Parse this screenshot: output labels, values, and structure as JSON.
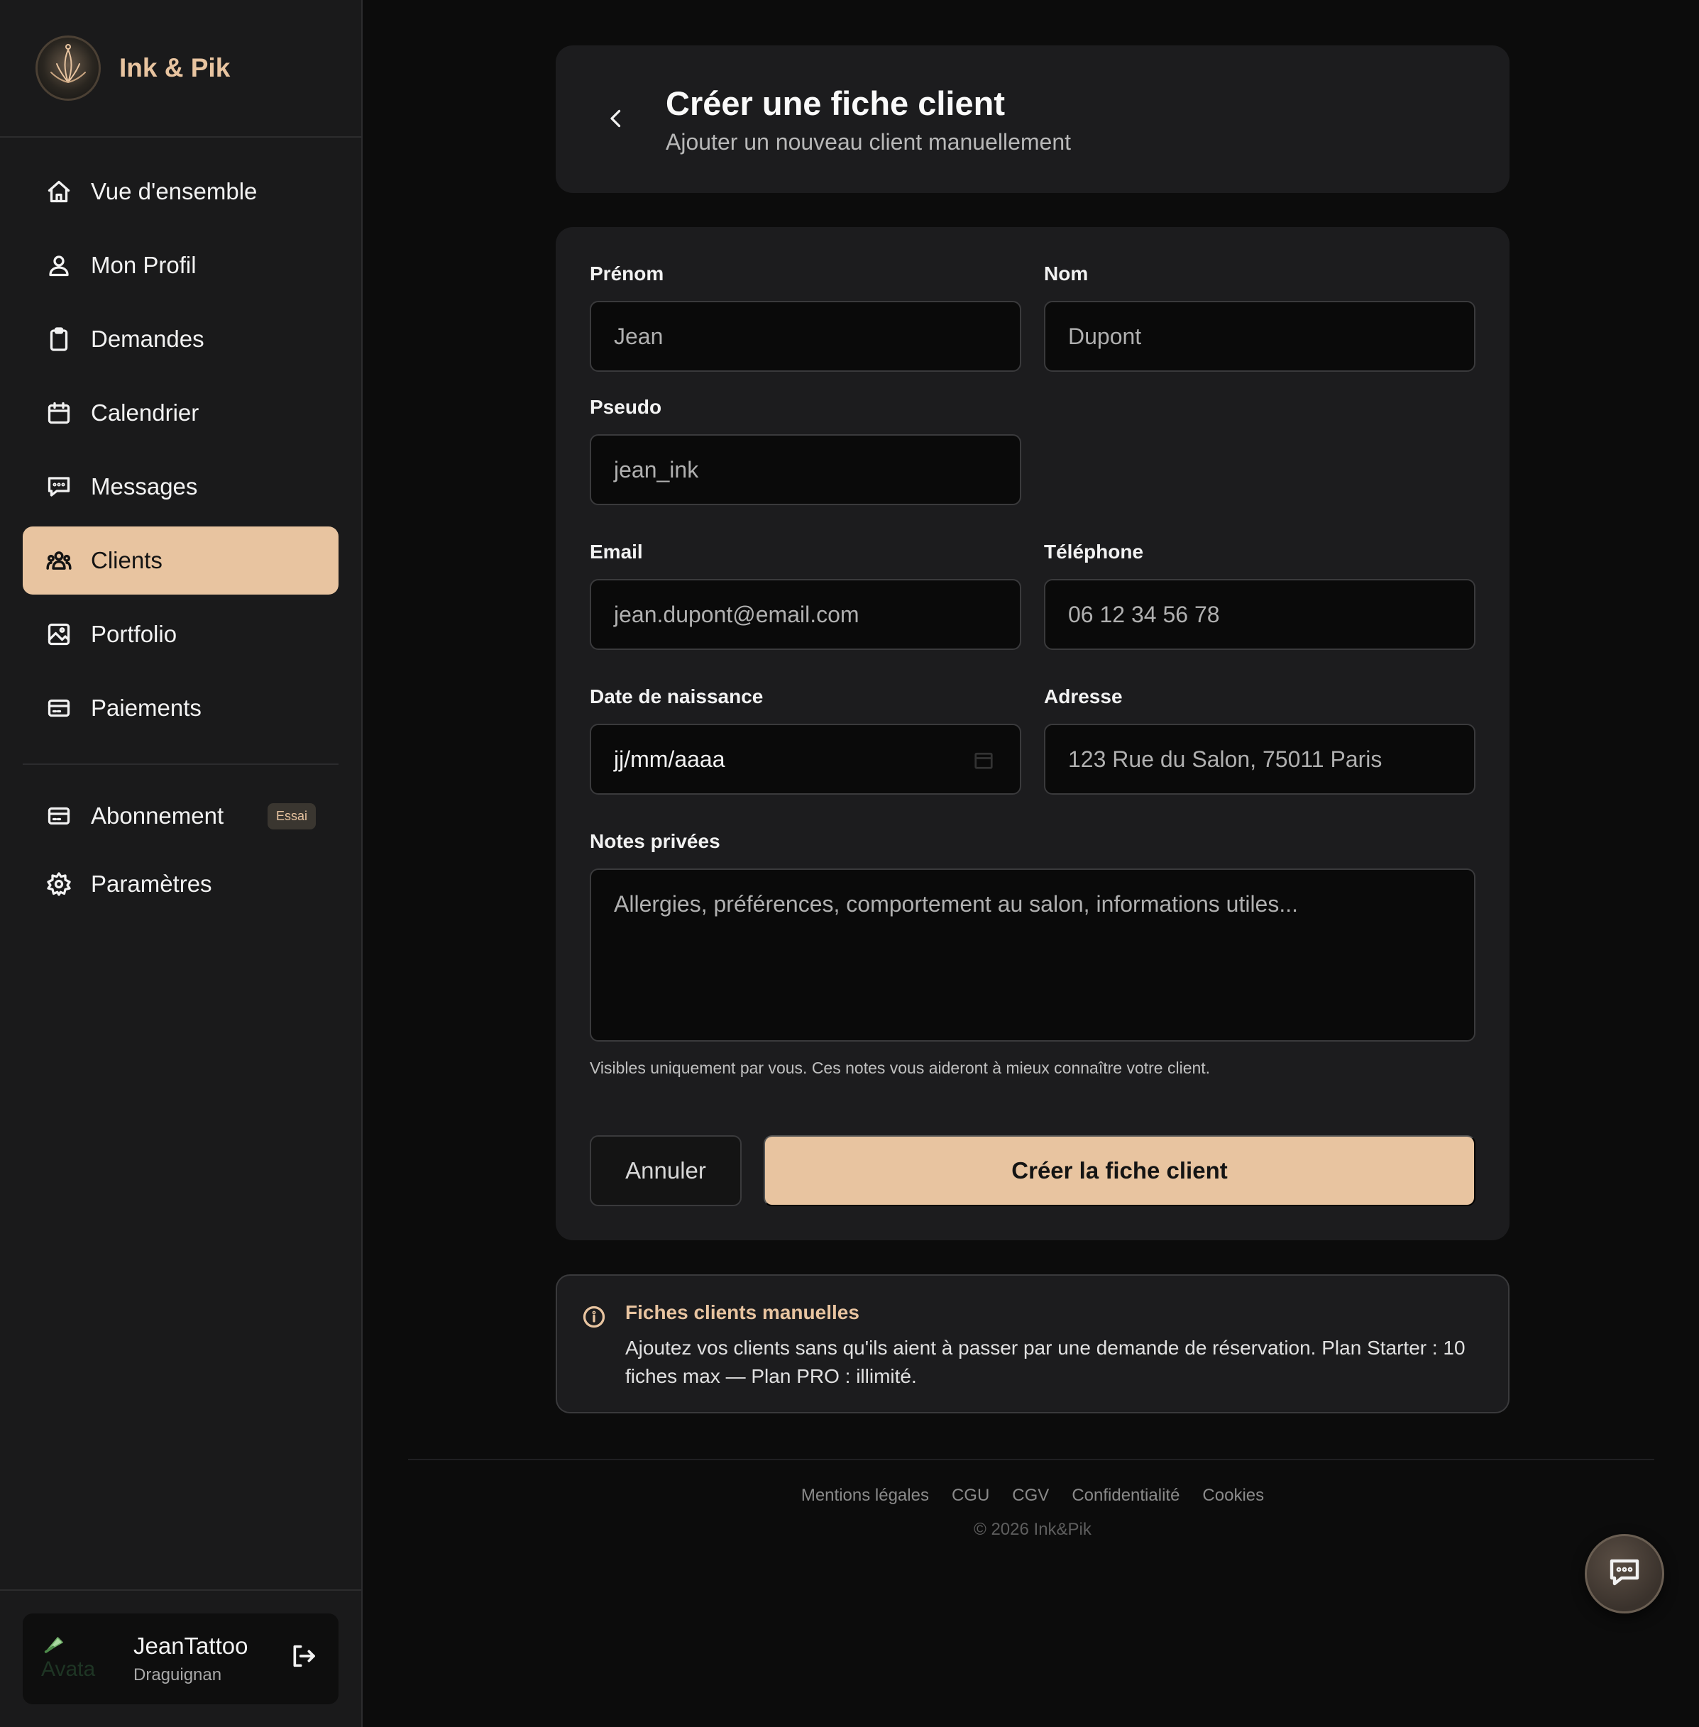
{
  "brand": {
    "name": "Ink & Pik"
  },
  "nav": {
    "items": [
      {
        "label": "Vue d'ensemble",
        "icon": "home-icon"
      },
      {
        "label": "Mon Profil",
        "icon": "user-icon"
      },
      {
        "label": "Demandes",
        "icon": "clipboard-icon"
      },
      {
        "label": "Calendrier",
        "icon": "calendar-icon"
      },
      {
        "label": "Messages",
        "icon": "message-icon"
      },
      {
        "label": "Clients",
        "icon": "users-icon",
        "active": true
      },
      {
        "label": "Portfolio",
        "icon": "image-icon"
      },
      {
        "label": "Paiements",
        "icon": "card-icon"
      }
    ],
    "secondary": [
      {
        "label": "Abonnement",
        "icon": "card-icon",
        "badge": "Essai"
      },
      {
        "label": "Paramètres",
        "icon": "gear-icon"
      }
    ]
  },
  "user": {
    "name": "JeanTattoo",
    "city": "Draguignan",
    "avatar_alt": "Avata"
  },
  "header": {
    "title": "Créer une fiche client",
    "subtitle": "Ajouter un nouveau client manuellement"
  },
  "form": {
    "prenom": {
      "label": "Prénom",
      "placeholder": "Jean"
    },
    "nom": {
      "label": "Nom",
      "placeholder": "Dupont"
    },
    "pseudo": {
      "label": "Pseudo",
      "placeholder": "jean_ink"
    },
    "email": {
      "label": "Email",
      "placeholder": "jean.dupont@email.com"
    },
    "telephone": {
      "label": "Téléphone",
      "placeholder": "06 12 34 56 78"
    },
    "date_naissance": {
      "label": "Date de naissance",
      "value": "jj/mm/aaaa"
    },
    "adresse": {
      "label": "Adresse",
      "placeholder": "123 Rue du Salon, 75011 Paris"
    },
    "notes": {
      "label": "Notes privées",
      "placeholder": "Allergies, préférences, comportement au salon, informations utiles...",
      "hint": "Visibles uniquement par vous. Ces notes vous aideront à mieux connaître votre client."
    },
    "cancel_label": "Annuler",
    "submit_label": "Créer la fiche client"
  },
  "info": {
    "title": "Fiches clients manuelles",
    "text": "Ajoutez vos clients sans qu'ils aient à passer par une demande de réservation. Plan Starter : 10 fiches max — Plan PRO : illimité."
  },
  "footer": {
    "links": [
      "Mentions légales",
      "CGU",
      "CGV",
      "Confidentialité",
      "Cookies"
    ],
    "copyright": "© 2026 Ink&Pik"
  },
  "colors": {
    "accent": "#e8c4a0",
    "background": "#0c0c0c",
    "sidebar": "#1a1a1b",
    "card": "#1c1c1e"
  }
}
